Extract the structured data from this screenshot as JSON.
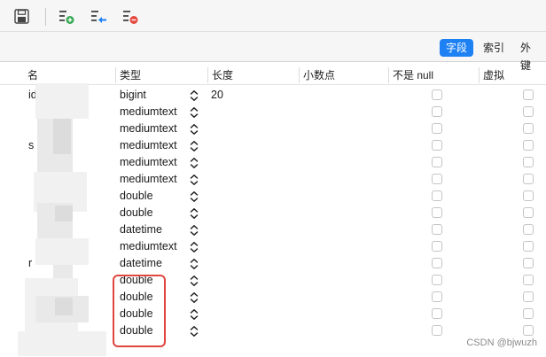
{
  "toolbar": {
    "icons": [
      "save-icon",
      "add-field-icon",
      "insert-field-icon",
      "delete-field-icon"
    ]
  },
  "tabs": [
    {
      "label": "字段",
      "active": true
    },
    {
      "label": "索引",
      "active": false
    },
    {
      "label": "外键",
      "active": false
    }
  ],
  "headers": {
    "name": "名",
    "type": "类型",
    "length": "长度",
    "decimals": "小数点",
    "not_null": "不是 null",
    "virtual": "虚拟"
  },
  "rows": [
    {
      "name": "id",
      "type": "bigint",
      "length": "20"
    },
    {
      "name": "",
      "type": "mediumtext",
      "length": ""
    },
    {
      "name": "",
      "type": "mediumtext",
      "length": ""
    },
    {
      "name": "s",
      "type": "mediumtext",
      "length": ""
    },
    {
      "name": "",
      "type": "mediumtext",
      "length": ""
    },
    {
      "name": "",
      "type": "mediumtext",
      "length": ""
    },
    {
      "name": "",
      "type": "double",
      "length": ""
    },
    {
      "name": "",
      "type": "double",
      "length": ""
    },
    {
      "name": "",
      "type": "datetime",
      "length": ""
    },
    {
      "name": "",
      "type": "mediumtext",
      "length": ""
    },
    {
      "name": "r",
      "type": "datetime",
      "length": ""
    },
    {
      "name": "",
      "type": "double",
      "length": ""
    },
    {
      "name": "",
      "type": "double",
      "length": ""
    },
    {
      "name": "",
      "type": "double",
      "length": ""
    },
    {
      "name": "",
      "type": "double",
      "length": ""
    }
  ],
  "watermark": "CSDN @bjwuzh",
  "colors": {
    "accent": "#1d80f3",
    "highlight": "#e0463f"
  }
}
